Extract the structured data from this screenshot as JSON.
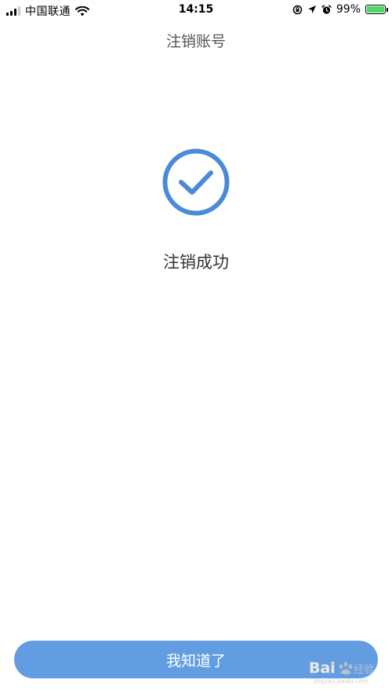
{
  "status_bar": {
    "carrier": "中国联通",
    "time": "14:15",
    "battery_percent": "99%",
    "battery_level": 0.99,
    "icons": [
      "signal-icon",
      "wifi-icon",
      "rotation-lock-icon",
      "location-icon",
      "alarm-icon",
      "battery-icon"
    ]
  },
  "nav": {
    "title": "注销账号"
  },
  "result": {
    "icon": "check-circle-icon",
    "message": "注销成功"
  },
  "footer": {
    "button_label": "我知道了"
  },
  "watermark": {
    "text": "Bai经验",
    "subtext": "jingyan.baidu.com"
  },
  "colors": {
    "accent": "#4A8AD8",
    "button": "#629DE1",
    "battery": "#4CD964"
  }
}
